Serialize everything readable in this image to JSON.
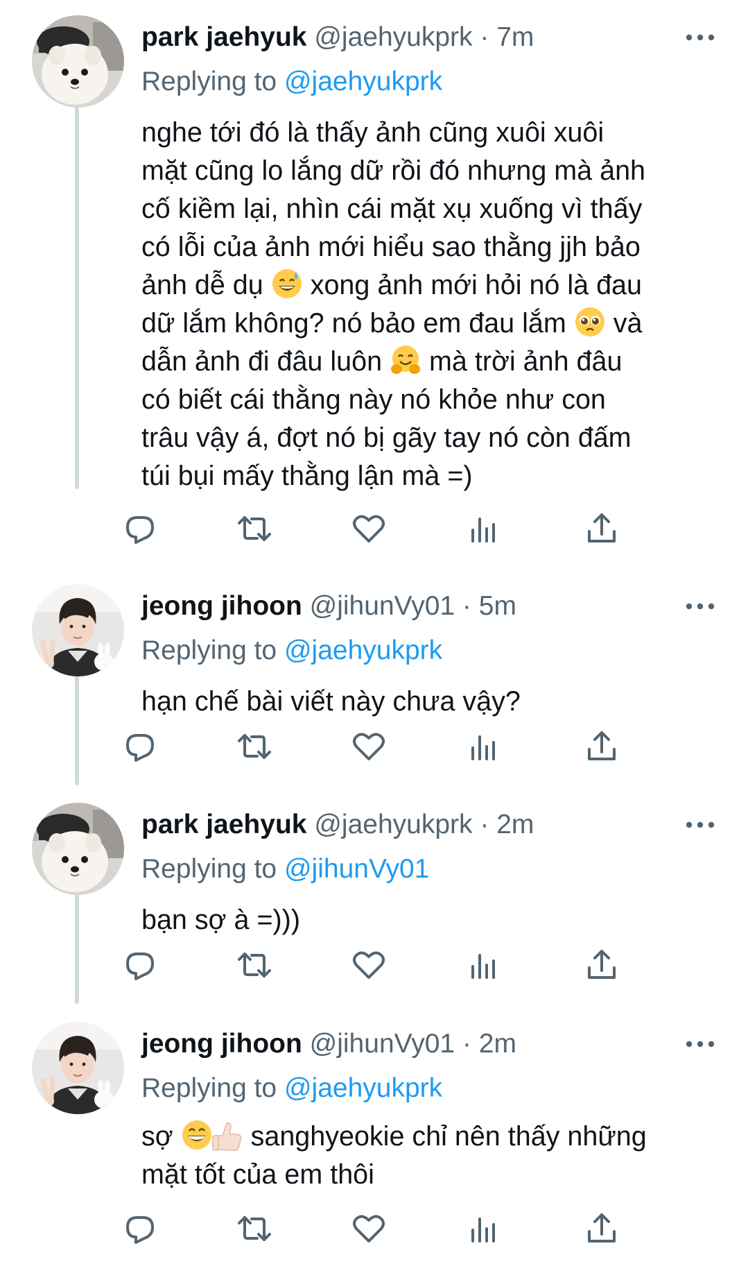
{
  "tweets": [
    {
      "author": "park jaehyuk",
      "handle": "@jaehyukprk",
      "time": "7m",
      "replying_prefix": "Replying to",
      "replying_to": "@jaehyukprk",
      "avatar": "pomeranian-avatar",
      "lines": [
        {
          "text": "nghe tới đó là thấy ảnh cũng xuôi xuôi"
        },
        {
          "text": "mặt cũng lo lắng dữ rồi đó nhưng mà ảnh"
        },
        {
          "text": "cố kiềm lại, nhìn cái mặt xụ xuống vì thấy"
        },
        {
          "text": "có lỗi của ảnh mới hiểu sao thằng jjh bảo"
        },
        {
          "before": "ảnh dễ dụ",
          "emoji": "grinning-sweat-emoji",
          "after": "xong ảnh mới hỏi nó là đau"
        },
        {
          "before": "dữ lắm không? nó bảo em đau lắm",
          "emoji": "pleading-face-emoji",
          "after": "và"
        },
        {
          "before": "dẫn ảnh đi đâu luôn",
          "emoji": "hugging-face-emoji",
          "after": "mà trời ảnh đâu"
        },
        {
          "text": "có biết cái thằng này nó khỏe như con"
        },
        {
          "text": "trâu vậy á, đợt nó bị gãy tay nó còn đấm"
        },
        {
          "text": "túi bụi mấy thằng lận mà =)"
        }
      ]
    },
    {
      "author": "jeong jihoon",
      "handle": "@jihunVy01",
      "time": "5m",
      "replying_prefix": "Replying to",
      "replying_to": "@jaehyukprk",
      "avatar": "person-peace-sign-avatar",
      "lines": [
        {
          "text": "hạn chế bài viết này chưa vậy?"
        }
      ]
    },
    {
      "author": "park jaehyuk",
      "handle": "@jaehyukprk",
      "time": "2m",
      "replying_prefix": "Replying to",
      "replying_to": "@jihunVy01",
      "avatar": "pomeranian-avatar",
      "lines": [
        {
          "text": "bạn sợ à =)))"
        }
      ]
    },
    {
      "author": "jeong jihoon",
      "handle": "@jihunVy01",
      "time": "2m",
      "replying_prefix": "Replying to",
      "replying_to": "@jaehyukprk",
      "avatar": "person-peace-sign-avatar",
      "lines": [
        {
          "before": "sợ",
          "emoji": "grinning-thumbs-up-emoji",
          "after": "sanghyeokie chỉ nên thấy những"
        },
        {
          "text": "mặt tốt của em thôi"
        }
      ]
    }
  ],
  "action_icons": [
    "reply-icon",
    "retweet-icon",
    "like-icon",
    "views-icon",
    "share-icon"
  ],
  "colors": {
    "text": "#0f1419",
    "secondary": "#536471",
    "link": "#1d9bf0",
    "thread_line": "#cfd9de"
  }
}
